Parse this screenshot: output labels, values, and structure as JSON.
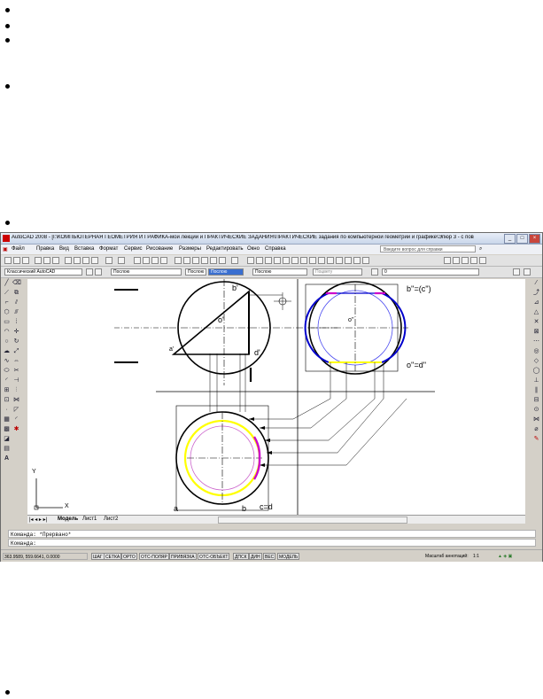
{
  "window": {
    "title": "AutoCAD 2008 - [I:\\КОМПЬЮТЕРНАЯ ГЕОМЕТРИЯ И ГРАФИКА-мои лекции и ПРАКТИЧЕСКИЕ ЗАДАНИЯ\\ПРАКТИЧЕСКИЕ задания по компьютерной геометрии и графике\\Эпюр 3 - с пов"
  },
  "menu": {
    "items": [
      "Файл",
      "Правка",
      "Вид",
      "Вставка",
      "Формат",
      "Сервис",
      "Рисование",
      "Размеры",
      "Редактировать",
      "Окно",
      "Справка"
    ],
    "help_placeholder": "Введите вопрос для справки"
  },
  "properties": {
    "workspace": "Классический AutoCAD",
    "layer": "Послою",
    "color": "Послою",
    "linetype": "Послою",
    "lineweight": "Послою",
    "plotstyle": "Поцвету",
    "layer_name": "0"
  },
  "drawing": {
    "labels": {
      "b_prime": "b'",
      "o_prime": "o'",
      "a_prime": "a'",
      "d_prime": "d'",
      "o_dprime": "o''",
      "b_eq_c": "b''=(c'')",
      "o_eq_d": "o''=d''",
      "a_bottom": "a",
      "b_bottom": "b",
      "c_eq_d": "c=d"
    },
    "ucs": {
      "y": "Y",
      "x": "X"
    }
  },
  "layout_tabs": [
    "Модель",
    "Лист1",
    "Лист2"
  ],
  "command": {
    "history": "Команда: *Прервано*",
    "prompt": "Команда:"
  },
  "status": {
    "coords": "363.9589, 559.6641, 0.0000",
    "toggles": [
      "ШАГ",
      "СЕТКА",
      "ОРТО",
      "ОТС-ПОЛЯР",
      "ПРИВЯЗКА",
      "ОТС-ОБЪЕКТ",
      "ДПСК",
      "ДИН",
      "ВЕС",
      "МОДЕЛЬ"
    ],
    "annotation_scale_label": "Масштаб аннотаций:",
    "annotation_scale": "1:1"
  },
  "colors": {
    "accent_blue": "#0000cc",
    "highlight_yellow": "#ffff00",
    "magenta": "#cc00cc"
  }
}
